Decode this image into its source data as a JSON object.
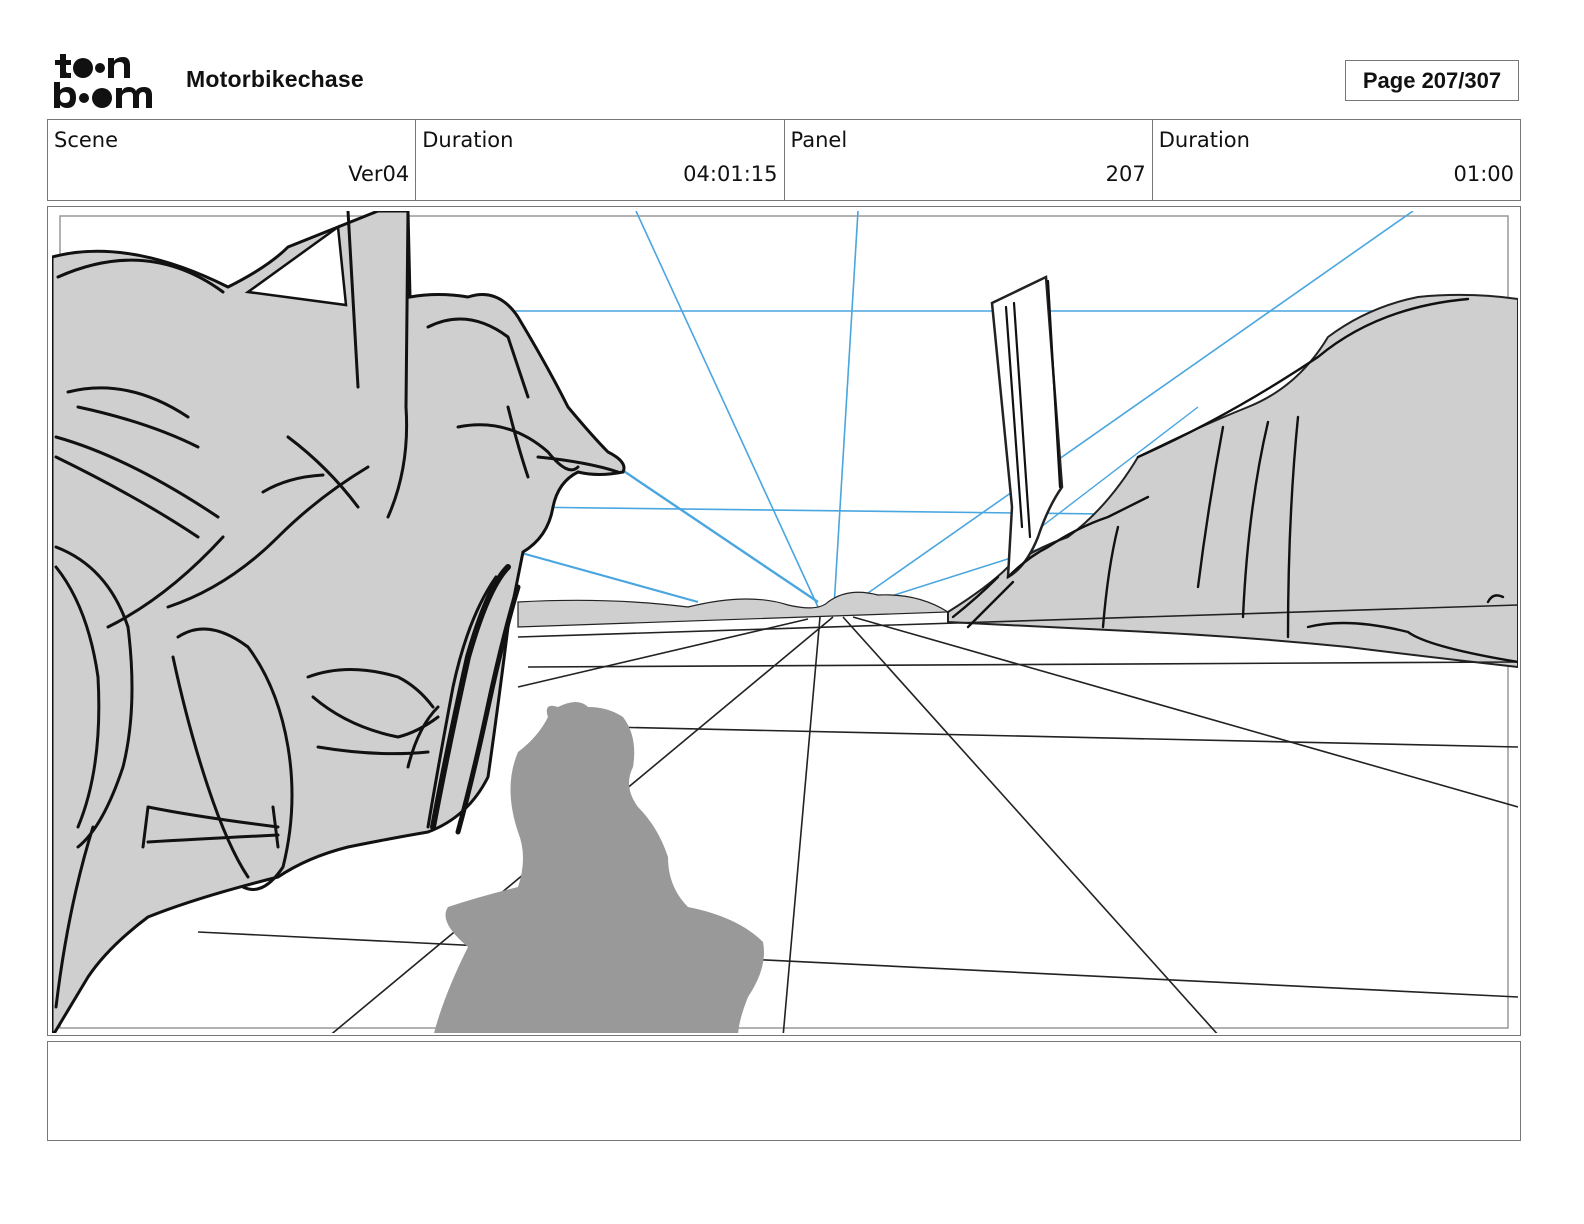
{
  "header": {
    "logo_text": "toonboom",
    "project_title": "Motorbikechase",
    "page_label": "Page 207/307"
  },
  "info": {
    "scene_label": "Scene",
    "scene_value": "Ver04",
    "duration_label": "Duration",
    "duration_value": "04:01:15",
    "panel_label": "Panel",
    "panel_value": "207",
    "panel_duration_label": "Duration",
    "panel_duration_value": "01:00"
  },
  "panel": {
    "image_icon": "storyboard-sketch",
    "colors": {
      "sketch_fill": "#cfcfcf",
      "shadow_fill": "#999999",
      "perspective_lines": "#4aa6e0",
      "ink": "#111111"
    }
  },
  "notes": {
    "text": ""
  }
}
